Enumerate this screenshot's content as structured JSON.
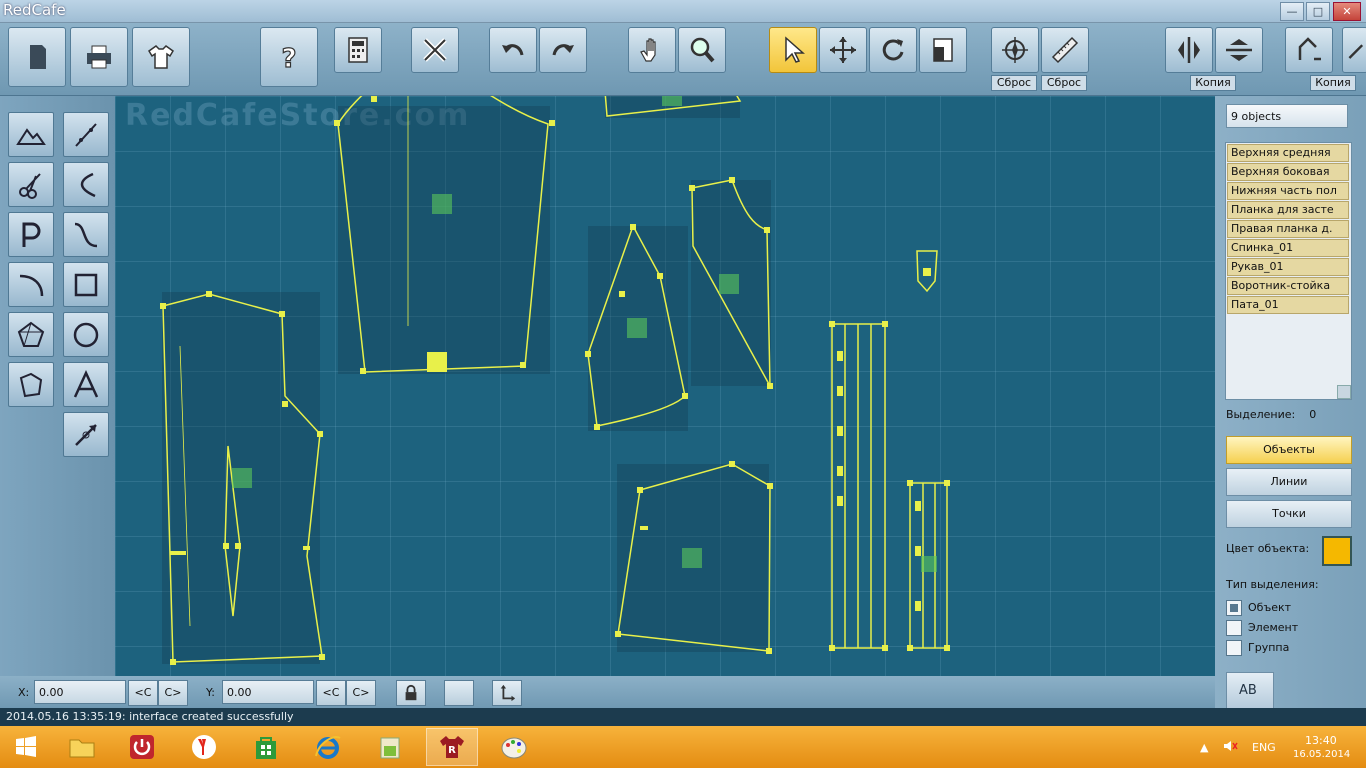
{
  "window": {
    "title": "RedCafe",
    "minimize": "—",
    "maximize": "□",
    "close": "✕"
  },
  "toolbar": {
    "reset_label_1": "Сброс",
    "reset_label_2": "Сброс",
    "copy_label_1": "Копия",
    "copy_label_2": "Копия"
  },
  "canvas": {
    "watermark": "RedCafeStore.com"
  },
  "right_panel": {
    "object_count": "9 objects",
    "objects": [
      "Верхняя средняя",
      "Верхняя боковая",
      "Нижняя часть пол",
      "Планка для засте",
      "Правая планка д.",
      "Спинка_01",
      "Рукав_01",
      "Воротник-стойка",
      "Пата_01"
    ],
    "selection_label": "Выделение:",
    "selection_count": "0",
    "mode_objects": "Объекты",
    "mode_lines": "Линии",
    "mode_points": "Точки",
    "color_label": "Цвет объекта:",
    "object_color": "#f5b800",
    "selection_type_label": "Тип выделения:",
    "selection_types": [
      "Объект",
      "Элемент",
      "Группа"
    ],
    "ab_button": "AB"
  },
  "bottom_bar": {
    "x_label": "X:",
    "x_value": "0.00",
    "y_label": "Y:",
    "y_value": "0.00",
    "left_btn": "<C",
    "right_btn": "C>"
  },
  "status": {
    "message": "2014.05.16 13:35:19: interface created successfully"
  },
  "tray": {
    "lang": "ENG",
    "time": "13:40",
    "date": "16.05.2014"
  },
  "colors": {
    "pattern_line": "#e8f04a",
    "canvas_bg": "#1d627e",
    "accent": "#f5c842"
  }
}
